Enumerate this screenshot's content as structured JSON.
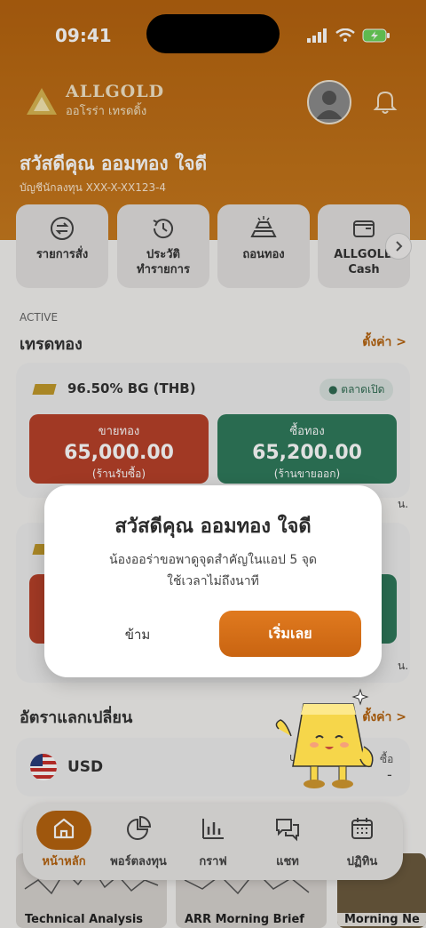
{
  "status_bar": {
    "time": "09:41"
  },
  "brand": {
    "name": "ALLGOLD",
    "subtitle": "ออโรร่า เทรดดิ้ง"
  },
  "header": {
    "greeting": "สวัสดีคุณ ออมทอง ใจดี",
    "account": "บัญชีนักลงทุน XXX-X-XX123-4"
  },
  "quick_actions": [
    {
      "line1": "รายการสั่ง",
      "line2": "",
      "icon": "swap-icon"
    },
    {
      "line1": "ประวัติ",
      "line2": "ทำรายการ",
      "icon": "history-icon"
    },
    {
      "line1": "ถอนทอง",
      "line2": "",
      "icon": "gold-bars-icon"
    },
    {
      "line1": "ALLGOLD",
      "line2": "Cash",
      "icon": "wallet-icon"
    }
  ],
  "trade_section": {
    "caption": "ACTIVE",
    "title": "เทรดทอง",
    "settings_link": "ตั้งค่า >",
    "card": {
      "title": "96.50% BG (THB)",
      "market_status": "● ตลาดเปิด",
      "sell": {
        "label": "ขายทอง",
        "value": "65,000.00",
        "sub": "(ร้านรับซื้อ)"
      },
      "buy": {
        "label": "ซื้อทอง",
        "value": "65,200.00",
        "sub": "(ร้านขายออก)"
      },
      "partial_right": "น."
    }
  },
  "exchange_section": {
    "title": "อัตราแลกเปลี่ยน",
    "settings_link": "ตั้งค่า >",
    "currency": "USD",
    "buy_label": "ซื้อ",
    "buy_value": "-",
    "partial_left": "u"
  },
  "research": [
    {
      "caption": "Technical Analysis"
    },
    {
      "caption": "ARR Morning Brief"
    },
    {
      "caption": "Morning Ne"
    }
  ],
  "tabbar": [
    {
      "label": "หน้าหลัก",
      "icon": "home-icon",
      "active": true
    },
    {
      "label": "พอร์ตลงทุน",
      "icon": "pie-chart-icon",
      "active": false
    },
    {
      "label": "กราฟ",
      "icon": "bar-chart-icon",
      "active": false
    },
    {
      "label": "แชท",
      "icon": "chat-icon",
      "active": false
    },
    {
      "label": "ปฏิทิน",
      "icon": "calendar-icon",
      "active": false
    }
  ],
  "modal": {
    "title": "สวัสดีคุณ ออมทอง ใจดี",
    "body_line1": "น้องออร่าขอพาดูจุดสำคัญในแอป 5 จุด",
    "body_line2": "ใช้เวลาไม่ถึงนาที",
    "skip": "ข้าม",
    "start": "เริ่มเลย"
  },
  "colors": {
    "brand_orange": "#b5630f",
    "sell_red": "#b8412a",
    "buy_green": "#2f7a5c",
    "cta_orange": "#e07a1f"
  }
}
